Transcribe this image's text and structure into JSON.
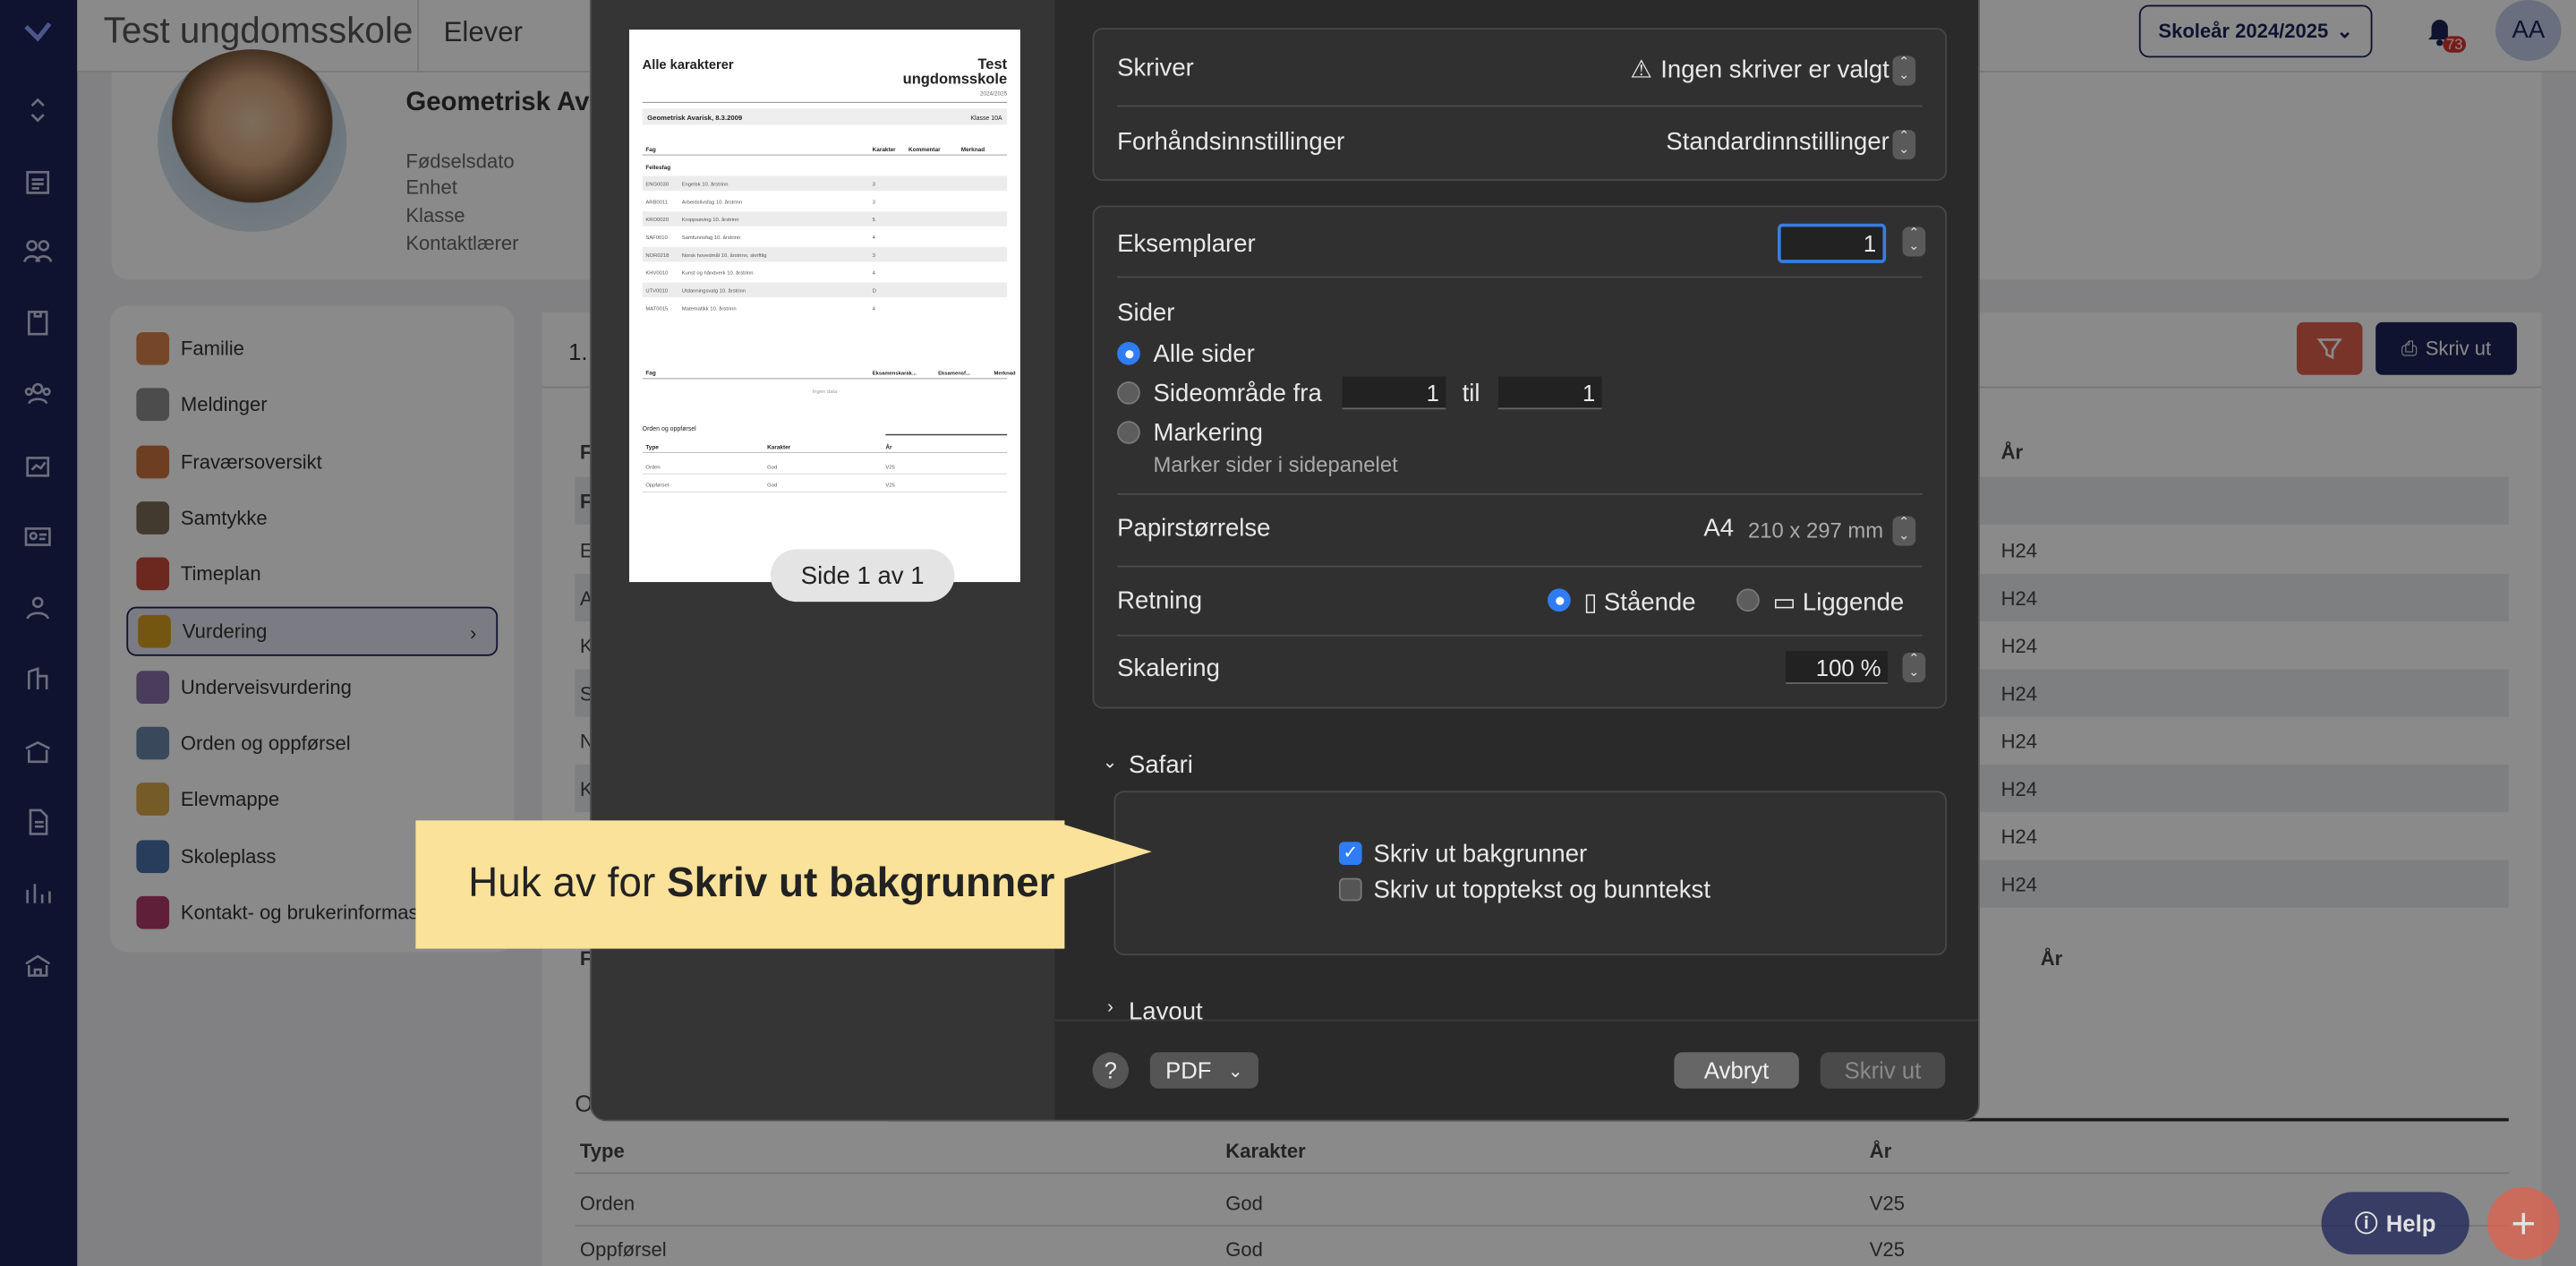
{
  "app": {
    "title": "Test ungdomsskole",
    "section": "Elever",
    "school_year": "Skoleår 2024/2025",
    "notif_count": "73",
    "user_initials": "AA"
  },
  "profile": {
    "name": "Geometrisk Avar",
    "labels": [
      "Fødselsdato",
      "Enhet",
      "Klasse",
      "Kontaktlærer"
    ]
  },
  "menu": [
    {
      "label": "Familie",
      "color": "#d9834a"
    },
    {
      "label": "Meldinger",
      "color": "#8c8c8c"
    },
    {
      "label": "Fraværsoversikt",
      "color": "#c9743f"
    },
    {
      "label": "Samtykke",
      "color": "#7a6b58"
    },
    {
      "label": "Timeplan",
      "color": "#c84a3a"
    },
    {
      "label": "Vurdering",
      "color": "#d9a020"
    },
    {
      "label": "Underveisvurdering",
      "color": "#8a6fa8"
    },
    {
      "label": "Orden og oppførsel",
      "color": "#6a88a8"
    },
    {
      "label": "Elevmappe",
      "color": "#d9a84a"
    },
    {
      "label": "Skoleplass",
      "color": "#4a6fa8"
    },
    {
      "label": "Kontakt- og brukerinformasj",
      "color": "#b03a6a"
    }
  ],
  "main": {
    "tab_num": "1.",
    "print_label": "Skriv ut",
    "col_year": "År",
    "rows": [
      "H24",
      "H24",
      "H24",
      "H24",
      "H24",
      "H24",
      "H24",
      "H24"
    ],
    "row_letters": [
      "E",
      "A",
      "K",
      "S",
      "N",
      "K",
      "",
      ""
    ],
    "second_year": "År",
    "bottom_header": [
      "Type",
      "Karakter",
      "År"
    ],
    "bottom_rows": [
      [
        "Orden",
        "God",
        "V25"
      ],
      [
        "Oppførsel",
        "God",
        "V25"
      ]
    ],
    "section_o": "O"
  },
  "preview": {
    "title": "Alle karakterer",
    "school": "Test ungdomsskole",
    "year": "2024/2025",
    "student": "Geometrisk Avarisk, 8.3.2009",
    "klasse": "Klasse 10A",
    "cols": [
      "Fag",
      "Karakter",
      "Kommentar",
      "Merknad"
    ],
    "group": "Fellesfag",
    "subjects": [
      [
        "ENG0030",
        "Engelsk 10. årstrinn",
        "3"
      ],
      [
        "ARB0011",
        "Arbeidslivsfag 10. årstrinn",
        "3"
      ],
      [
        "KRO0020",
        "Kroppsøving 10. årstrinn",
        "5"
      ],
      [
        "SAF0010",
        "Samfunnsfag 10. årstrinn",
        "4"
      ],
      [
        "NOR0218",
        "Norsk hovedmål 10. årstrinn, skriftlig",
        "3"
      ],
      [
        "KHV0010",
        "Kunst og håndverk 10. årstrinn",
        "4"
      ],
      [
        "UTV0010",
        "Utdanningsvalg 10. årstrinn",
        "D"
      ],
      [
        "MAT0015",
        "Matematikk 10. årstrinn",
        "4"
      ]
    ],
    "exam_cols": [
      "Fag",
      "Eksamenskarak...",
      "Eksamensf...",
      "Merknad"
    ],
    "nodata": "Ingen data",
    "orden_title": "Orden og oppførsel",
    "orden_cols": [
      "Type",
      "Karakter",
      "År"
    ],
    "orden_rows": [
      [
        "Orden",
        "God",
        "V25"
      ],
      [
        "Oppførsel",
        "God",
        "V25"
      ]
    ],
    "page_label": "Side 1 av 1"
  },
  "dialog": {
    "printer_label": "Skriver",
    "printer_value": "Ingen skriver er valgt",
    "presets_label": "Forhåndsinnstillinger",
    "presets_value": "Standardinnstillinger",
    "copies_label": "Eksemplarer",
    "copies_value": "1",
    "pages_label": "Sider",
    "all_pages": "Alle sider",
    "range_label": "Sideområde fra",
    "range_from": "1",
    "range_to_label": "til",
    "range_to": "1",
    "selection_label": "Markering",
    "selection_hint": "Marker sider i sidepanelet",
    "paper_label": "Papirstørrelse",
    "paper_value": "A4",
    "paper_dims": "210 x 297 mm",
    "orientation_label": "Retning",
    "portrait": "Stående",
    "landscape": "Liggende",
    "scale_label": "Skalering",
    "scale_value": "100 %",
    "safari_label": "Safari",
    "print_backgrounds": "Skriv ut bakgrunner",
    "print_headers": "Skriv ut topptekst og bunntekst",
    "layout_label": "Layout",
    "help": "?",
    "pdf_label": "PDF",
    "cancel": "Avbryt",
    "print": "Skriv ut"
  },
  "callout": {
    "prefix": "Huk av for ",
    "bold": "Skriv ut bakgrunner"
  },
  "help_label": "Help"
}
